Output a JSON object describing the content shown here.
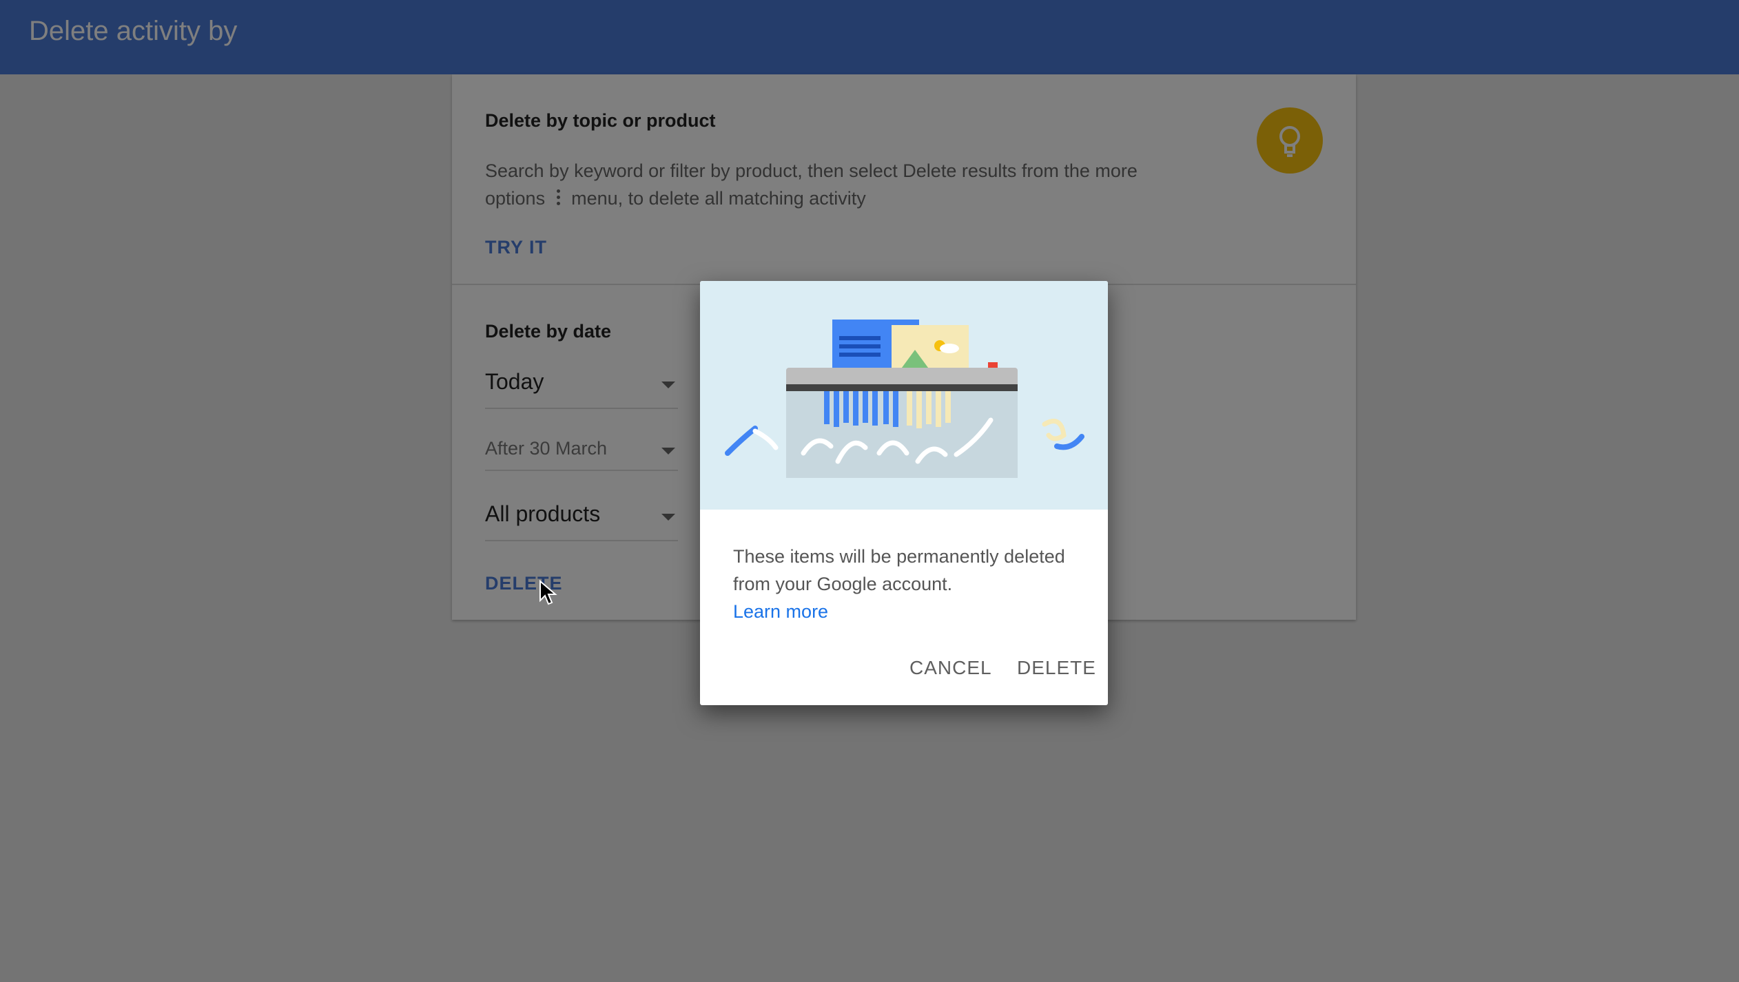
{
  "header": {
    "title": "Delete activity by"
  },
  "topic_section": {
    "title": "Delete by topic or product",
    "desc_part1": "Search by keyword or filter by product, then select Delete results from the more options",
    "desc_part2": "menu, to delete all matching activity",
    "try_label": "TRY IT",
    "icon": "lightbulb-icon"
  },
  "date_section": {
    "title": "Delete by date",
    "range_value": "Today",
    "after_value": "After 30 March",
    "products_value": "All products",
    "delete_label": "DELETE"
  },
  "dialog": {
    "message": "These items will be permanently deleted from your Google account.",
    "learn_more": "Learn more",
    "cancel_label": "CANCEL",
    "delete_label": "DELETE",
    "illustration": "paper-shredder-illustration"
  },
  "colors": {
    "header_bg": "#4a7ad6",
    "accent": "#4a7ad6",
    "bulb": "#f6c00f",
    "illustration_bg": "#dbedf4"
  }
}
